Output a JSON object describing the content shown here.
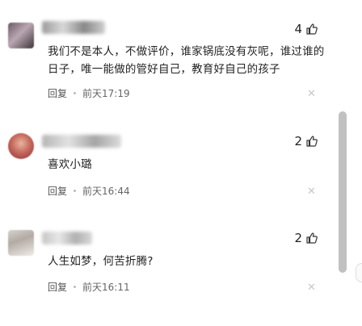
{
  "comments": [
    {
      "likes": "4",
      "text": "我们不是本人，不做评价，谁家锅底没有灰呢，谁过谁的日子，唯一能做的管好自己，教育好自己的孩子",
      "reply_label": "回复",
      "time": "前天17:19"
    },
    {
      "likes": "2",
      "text": "喜欢小璐",
      "reply_label": "回复",
      "time": "前天16:44"
    },
    {
      "likes": "2",
      "text": "人生如梦，何苦折腾?",
      "reply_label": "回复",
      "time": "前天16:11"
    }
  ],
  "icons": {
    "like": "thumbs-up-icon",
    "close": "close-icon"
  },
  "colors": {
    "text": "#222222",
    "meta": "#666666",
    "scrollbar": "#c1c1c1"
  }
}
